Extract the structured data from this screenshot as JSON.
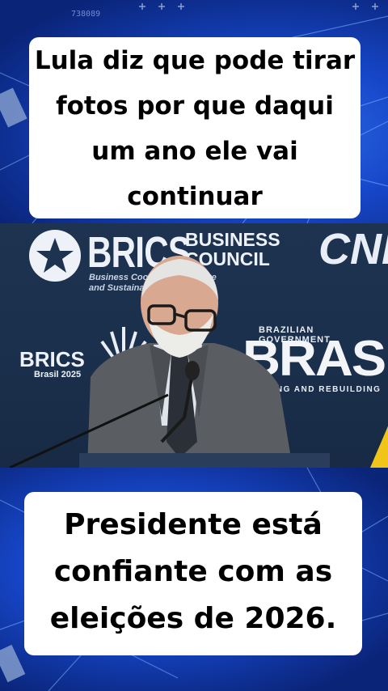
{
  "top_caption": {
    "text": "Lula diz que pode tirar\nfotos por que daqui\num ano ele vai\ncontinuar"
  },
  "bottom_caption": {
    "text": "Presidente está\nconfiante com as\neleições de 2026."
  },
  "video": {
    "brics_logo_text": "BRICS",
    "business_council_text": "BUSINESS\nCOUNCIL",
    "subtitle_text": "Business Coop          Inclusive\nand Sustaina",
    "cni_text": "CNI",
    "brics_small_text": "BRICS",
    "brasil_year_text": "Brasil 2025",
    "gov_text": "BRAZILIAN GOVERNMENT",
    "brasil_big_text": "BRASIL",
    "rebuilding_text": "TING AND REBUILDING"
  },
  "tv_mark": "738089",
  "colors": {
    "background_blue": "#1646c8",
    "caption_bg": "#ffffff",
    "caption_text": "#000000",
    "stage_dark": "#1d3350"
  }
}
